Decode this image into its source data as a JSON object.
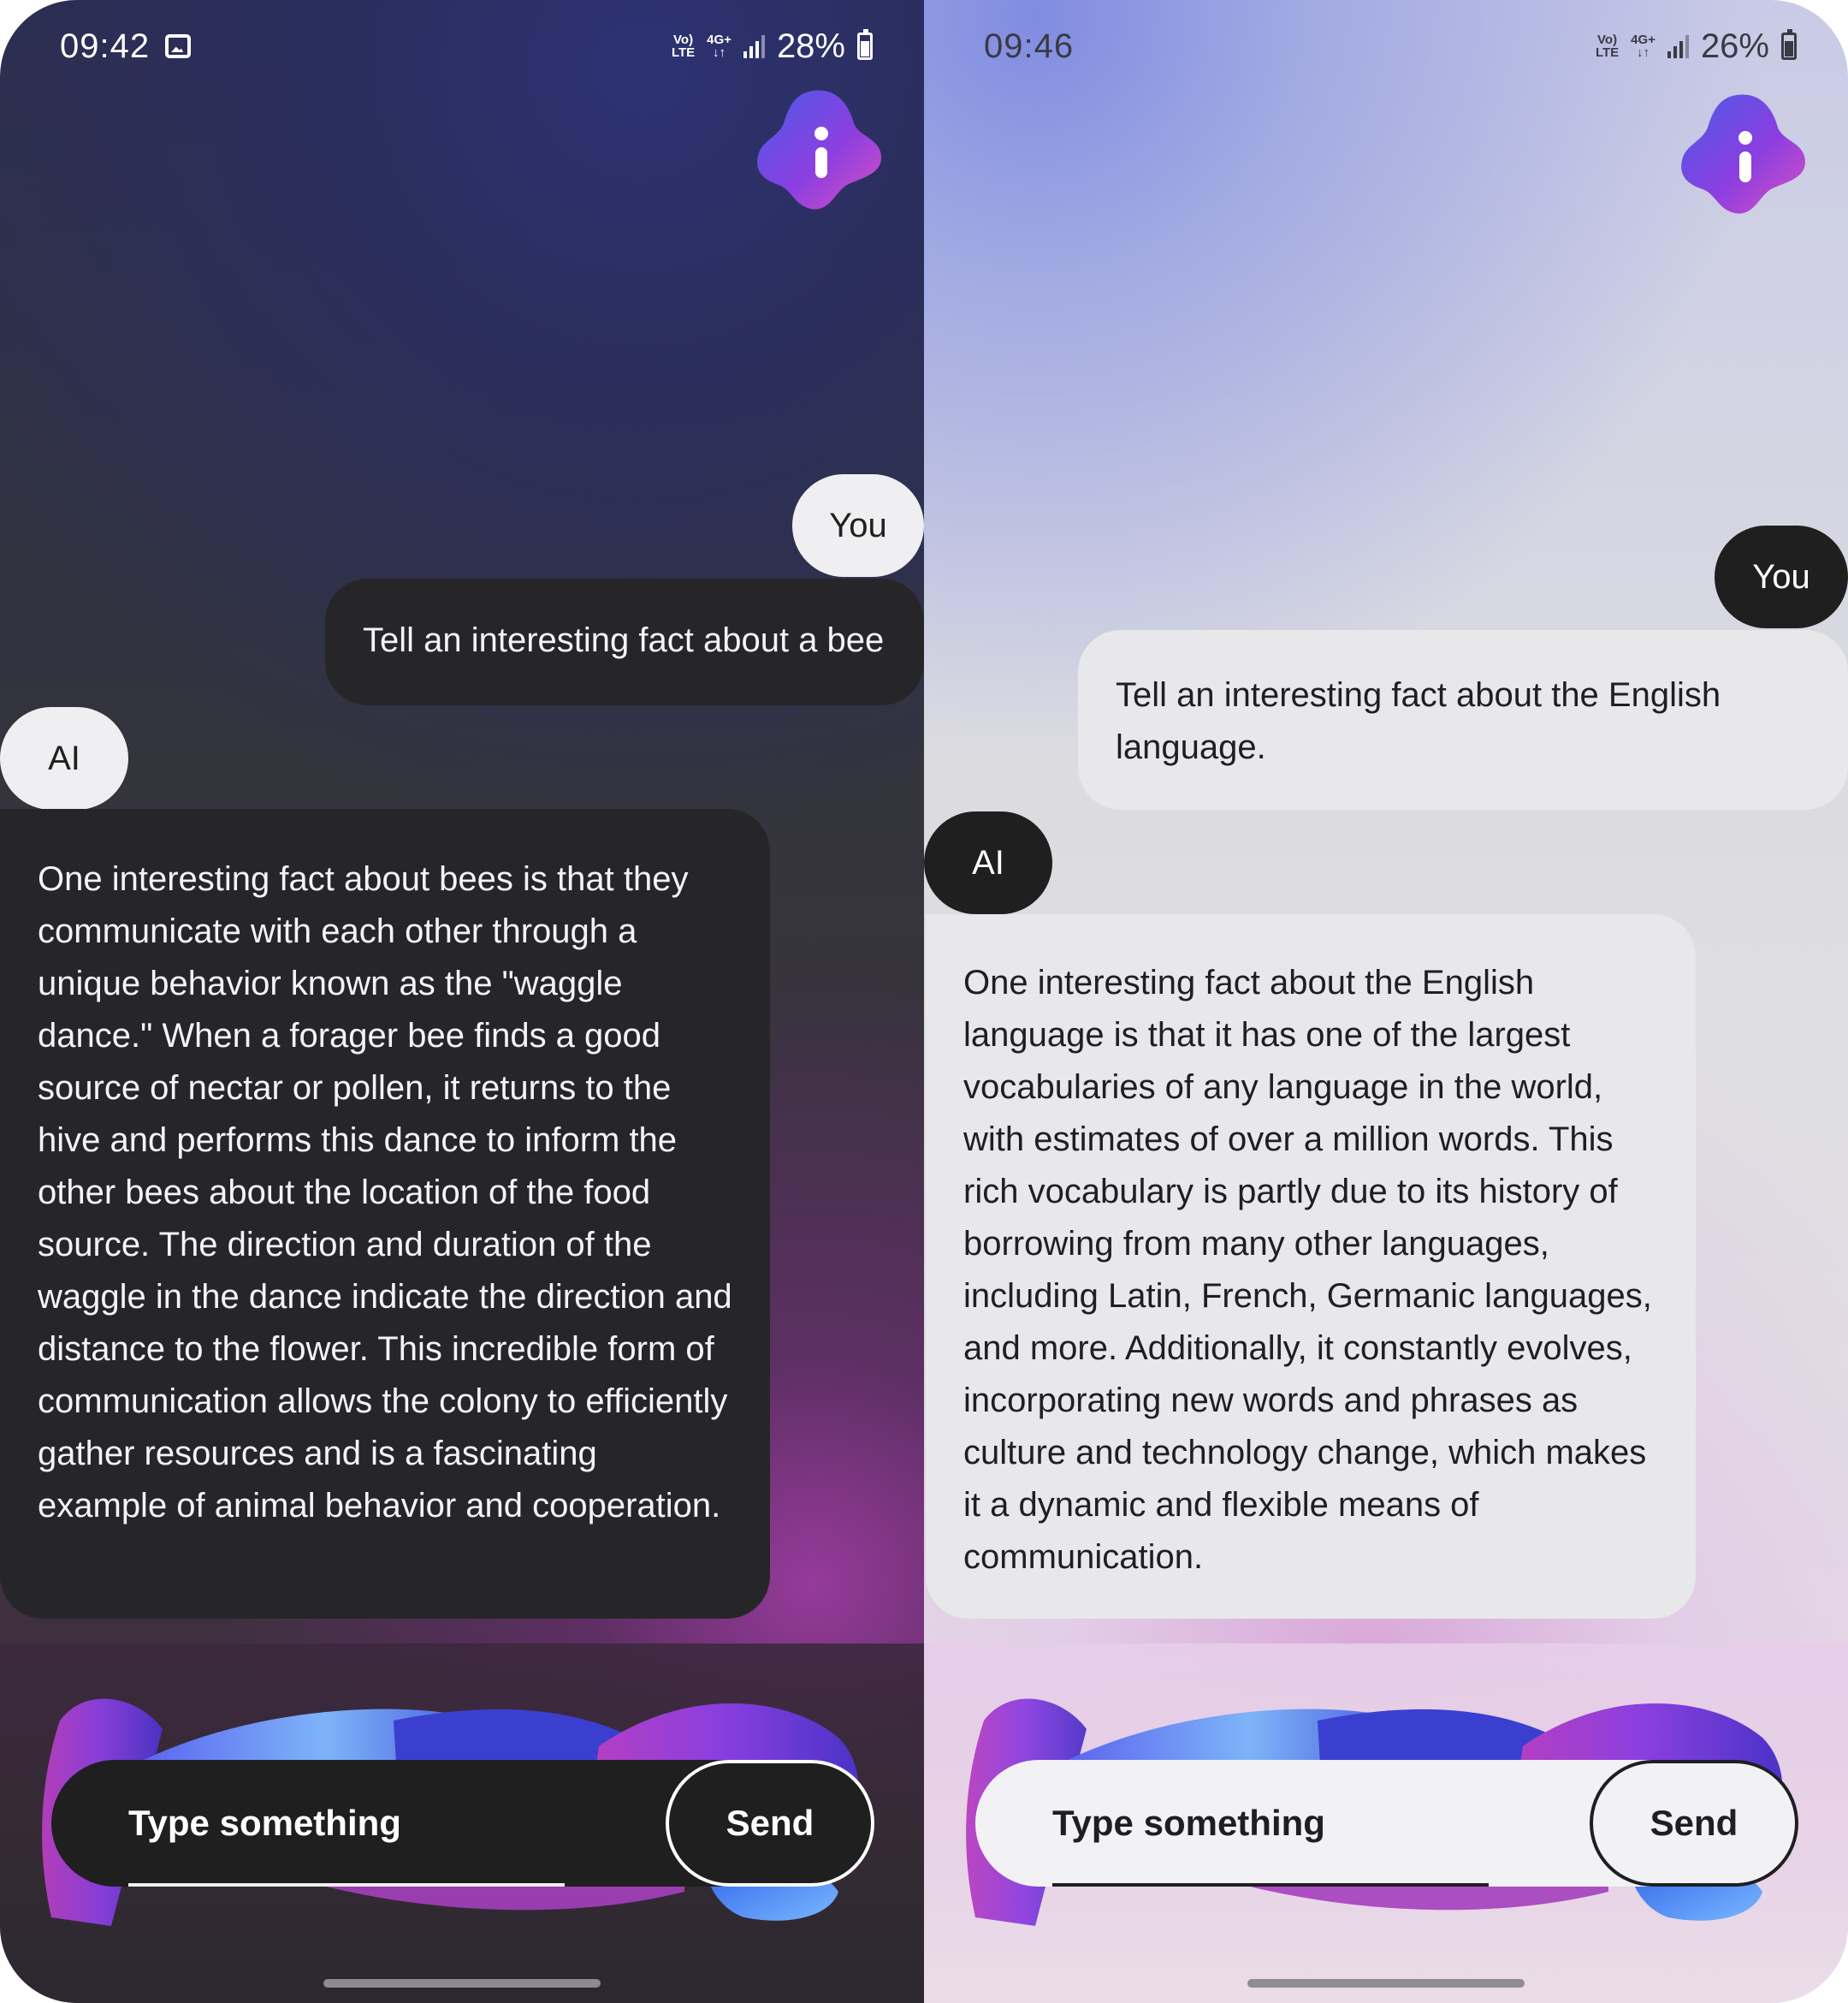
{
  "screens": [
    {
      "theme": "dark",
      "status": {
        "time": "09:42",
        "net_top": "Vo)",
        "net_bottom": "LTE",
        "gen_top": "4G+",
        "gen_bottom": "↓↑",
        "battery": "28%"
      },
      "assistant_icon": "info-blob-icon",
      "user_chip": "You",
      "user_message": "Tell an interesting fact about a bee",
      "ai_chip": "AI",
      "ai_message": "One interesting fact about bees is that they communicate with each other through a unique behavior known as the \"waggle dance.\" When a forager bee finds a good source of nectar or pollen, it returns to the hive and performs this dance to inform the other bees about the location of the food source. The direction and duration of the waggle in the dance indicate the direction and distance to the flower. This incredible form of communication allows the colony to efficiently gather resources and is a fascinating example of animal behavior and cooperation.",
      "input": {
        "placeholder": "Type something",
        "value": ""
      },
      "send_label": "Send"
    },
    {
      "theme": "light",
      "status": {
        "time": "09:46",
        "net_top": "Vo)",
        "net_bottom": "LTE",
        "gen_top": "4G+",
        "gen_bottom": "↓↑",
        "battery": "26%"
      },
      "assistant_icon": "info-blob-icon",
      "user_chip": "You",
      "user_message": "Tell an interesting fact about the English language.",
      "ai_chip": "AI",
      "ai_message": "One interesting fact about the English language is that it has one of the largest vocabularies of any language in the world, with estimates of over a million words. This rich vocabulary is partly due to its history of borrowing from many other languages, including Latin, French, Germanic languages, and more. Additionally, it constantly evolves, incorporating new words and phrases as culture and technology change, which makes it a dynamic and flexible means of communication.",
      "input": {
        "placeholder": "Type something",
        "value": ""
      },
      "send_label": "Send"
    }
  ],
  "colors": {
    "dark_bubble": "#262629",
    "light_bubble": "#e8e8ea",
    "accent_purple": "#8a3fe0",
    "accent_blue": "#3b5fe6"
  }
}
